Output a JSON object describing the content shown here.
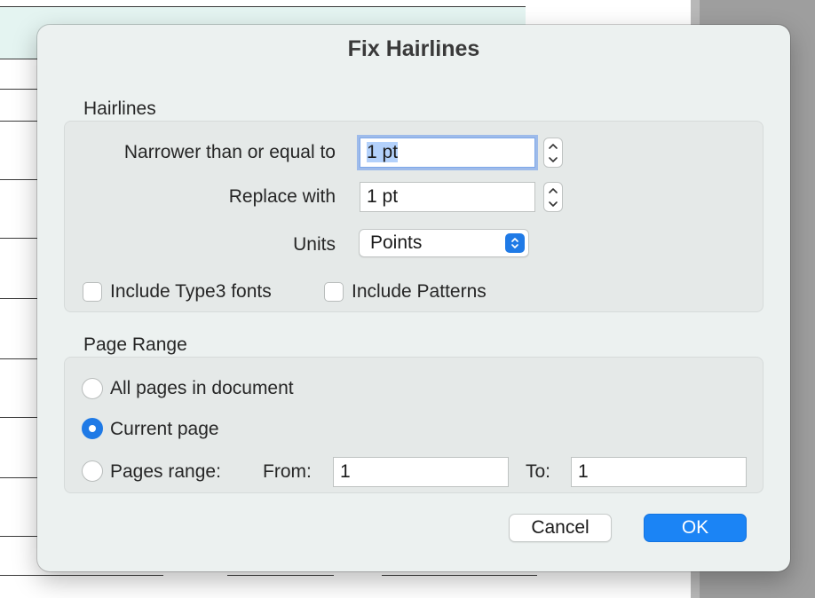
{
  "dialog": {
    "title": "Fix Hairlines",
    "hairlines": {
      "section_label": "Hairlines",
      "narrower": {
        "label": "Narrower than or equal to",
        "value": "1 pt"
      },
      "replace": {
        "label": "Replace with",
        "value": "1 pt"
      },
      "units": {
        "label": "Units",
        "selected": "Points"
      },
      "include_type3": {
        "label": "Include Type3 fonts",
        "checked": false
      },
      "include_patterns": {
        "label": "Include Patterns",
        "checked": false
      }
    },
    "page_range": {
      "section_label": "Page Range",
      "options": {
        "all": {
          "label": "All pages in document",
          "selected": false
        },
        "current": {
          "label": "Current page",
          "selected": true
        },
        "range": {
          "label": "Pages range:",
          "selected": false
        }
      },
      "from": {
        "label": "From:",
        "value": "1"
      },
      "to": {
        "label": "To:",
        "value": "1"
      }
    },
    "buttons": {
      "cancel": "Cancel",
      "ok": "OK"
    }
  },
  "colors": {
    "accent": "#1b84f5",
    "dialog_bg": "#ecf1f0",
    "group_bg": "#e5e9e8",
    "focus_ring": "#7ea7e8",
    "text_selection": "#b3d1fb"
  },
  "icons": {
    "stepper": "chevron-up-down-icon",
    "popup": "chevron-up-down-icon"
  }
}
